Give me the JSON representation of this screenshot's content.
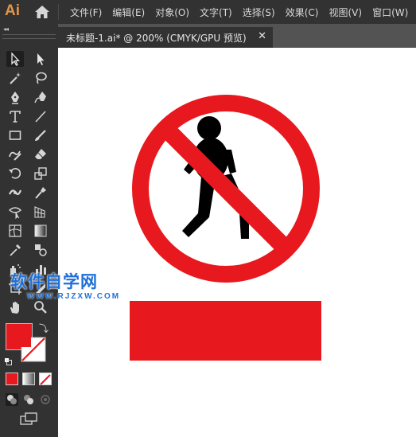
{
  "app": {
    "logo": "Ai",
    "menus": [
      "文件(F)",
      "编辑(E)",
      "对象(O)",
      "文字(T)",
      "选择(S)",
      "效果(C)",
      "视图(V)",
      "窗口(W)"
    ]
  },
  "toolbar": {
    "collapse_glyph": "◂◂",
    "fill_color": "#e8191e",
    "stroke": "none",
    "tools": [
      "selection",
      "direct-selection",
      "magic-wand",
      "lasso",
      "pen",
      "curvature",
      "type",
      "line-segment",
      "rectangle",
      "paintbrush",
      "shaper",
      "eraser",
      "rotate",
      "scale",
      "width",
      "puppet-warp",
      "free-transform",
      "perspective-grid",
      "mesh",
      "gradient",
      "eyedropper",
      "blend",
      "symbol-sprayer",
      "column-graph",
      "artboard",
      "slice",
      "hand",
      "zoom"
    ]
  },
  "document": {
    "tab_title": "未标题-1.ai* @ 200% (CMYK/GPU 预览)",
    "close_glyph": "✕"
  },
  "artwork": {
    "sign_red": "#e8191e",
    "figure_color": "#000000",
    "banner_red": "#e8191e"
  },
  "watermark": {
    "title": "软件自学网",
    "url": "WWW.RJZXW.COM",
    "color": "#1f6fd8"
  }
}
